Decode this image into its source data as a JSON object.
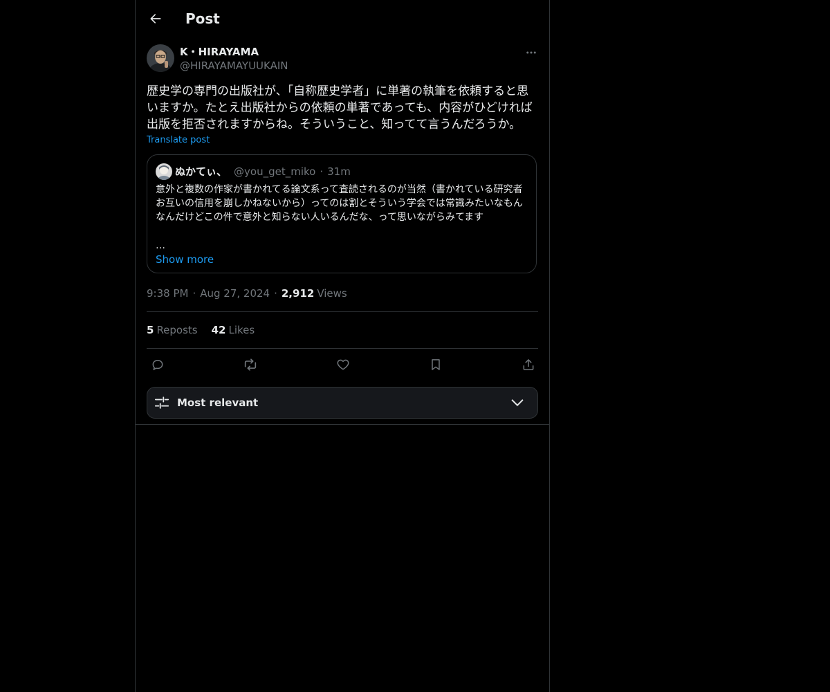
{
  "header": {
    "title": "Post"
  },
  "post": {
    "author_name": "K・HIRAYAMA",
    "author_handle": "@HIRAYAMAYUUKAIN",
    "text": "歴史学の専門の出版社が、「自称歴史学者」に単著の執筆を依頼すると思いますか。たとえ出版社からの依頼の単著であっても、内容がひどければ出版を拒否されますからね。そういうこと、知ってて言うんだろうか。",
    "translate_label": "Translate post",
    "time": "9:38 PM",
    "date": "Aug 27, 2024",
    "views_count": "2,912",
    "views_label": "Views"
  },
  "quote": {
    "author_name": "ぬかてぃ、",
    "author_handle": "@you_get_miko",
    "time_ago": "31m",
    "text": "意外と複数の作家が書かれてる論文系って査読されるのが当然（書かれている研究者お互いの信用を崩しかねないから）ってのは割とそういう学会では常識みたいなもんなんだけどこの件で意外と知らない人いるんだな、って思いながらみてます",
    "ellipsis": "…",
    "show_more_label": "Show more"
  },
  "stats": {
    "reposts_count": "5",
    "reposts_label": "Reposts",
    "likes_count": "42",
    "likes_label": "Likes"
  },
  "sort": {
    "label": "Most relevant"
  },
  "separator": "·",
  "colors": {
    "background": "#000000",
    "text_primary": "#e7e9ea",
    "text_secondary": "#71767b",
    "accent": "#1d9bf0",
    "border": "#2f3336",
    "sort_bar_bg": "#16181c"
  },
  "icons": {
    "back": "arrow-left-icon",
    "more": "more-horizontal-icon",
    "reply": "reply-icon",
    "repost": "repost-icon",
    "like": "heart-icon",
    "bookmark": "bookmark-icon",
    "share": "share-icon",
    "sort": "sliders-icon",
    "chevron": "chevron-down-icon"
  }
}
